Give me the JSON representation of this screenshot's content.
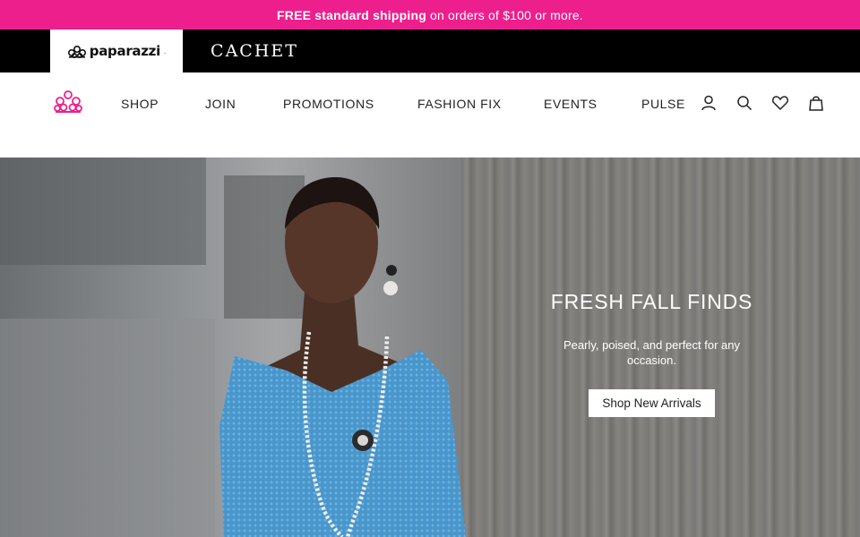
{
  "promo": {
    "bold": "FREE standard shipping",
    "rest": "on orders of $100 or more."
  },
  "brands": {
    "active": "paparazzi",
    "active_mark": ".",
    "cachet": "CACHET"
  },
  "nav": {
    "items": [
      {
        "label": "SHOP"
      },
      {
        "label": "JOIN"
      },
      {
        "label": "PROMOTIONS"
      },
      {
        "label": "FASHION FIX"
      },
      {
        "label": "EVENTS"
      },
      {
        "label": "PULSE"
      }
    ],
    "icons": [
      "account-icon",
      "search-icon",
      "heart-icon",
      "bag-icon"
    ]
  },
  "hero": {
    "title": "FRESH FALL FINDS",
    "subtitle": "Pearly, poised, and perfect for any occasion.",
    "cta": "Shop New Arrivals"
  },
  "colors": {
    "brand_pink": "#ec1f8c",
    "black": "#000000"
  }
}
